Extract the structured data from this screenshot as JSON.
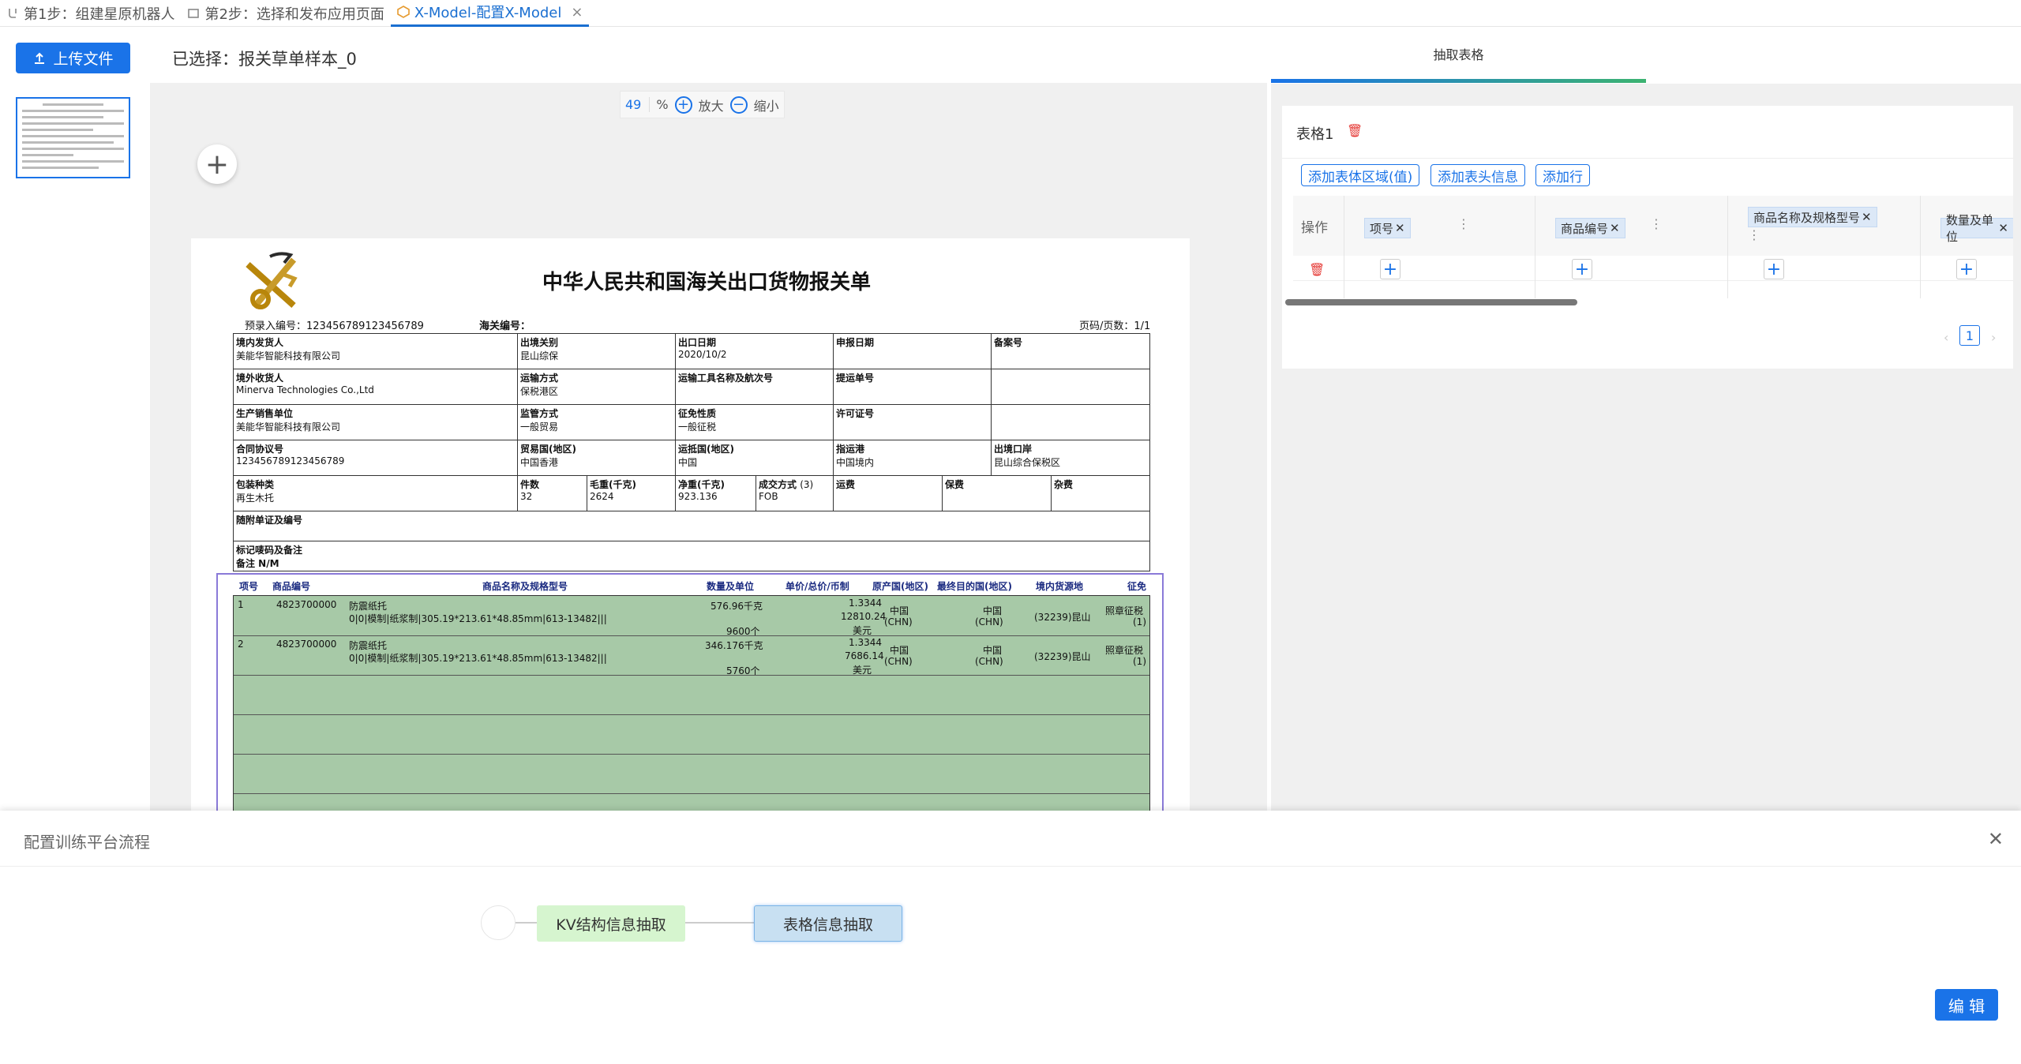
{
  "tabs": [
    {
      "label": "第1步：组建星原机器人"
    },
    {
      "label": "第2步：选择和发布应用页面"
    },
    {
      "label": "X-Model-配置X-Model"
    }
  ],
  "toolbar": {
    "upload_label": "上传文件",
    "selected_text": "已选择：报关草单样本_0"
  },
  "zoom": {
    "value": "49",
    "unit": "%",
    "zoom_in": "放大",
    "zoom_out": "缩小"
  },
  "document": {
    "title": "中华人民共和国海关出口货物报关单",
    "pre_entry": "预录入编号：123456789123456789",
    "customs_no": "海关编号：",
    "page": "页码/页数：1/1",
    "rows": [
      [
        {
          "h": "境内发货人",
          "v": "美能华智能科技有限公司"
        },
        {
          "h": "出境关别",
          "v": "昆山综保"
        },
        {
          "h": "出口日期",
          "v": "2020/10/2"
        },
        {
          "h": "申报日期",
          "v": ""
        },
        {
          "h": "备案号",
          "v": ""
        }
      ],
      [
        {
          "h": "境外收货人",
          "v": "Minerva Technologies Co.,Ltd"
        },
        {
          "h": "运输方式",
          "v": "保税港区"
        },
        {
          "h": "运输工具名称及航次号",
          "v": ""
        },
        {
          "h": "提运单号",
          "v": ""
        },
        {
          "h": "",
          "v": ""
        }
      ],
      [
        {
          "h": "生产销售单位",
          "v": "美能华智能科技有限公司"
        },
        {
          "h": "监管方式",
          "v": "一般贸易"
        },
        {
          "h": "征免性质",
          "v": "一般征税"
        },
        {
          "h": "许可证号",
          "v": ""
        },
        {
          "h": "",
          "v": ""
        }
      ],
      [
        {
          "h": "合同协议号",
          "v": "123456789123456789"
        },
        {
          "h": "贸易国(地区)",
          "v": "中国香港"
        },
        {
          "h": "运抵国(地区)",
          "v": "中国"
        },
        {
          "h": "指运港",
          "v": "中国境内"
        },
        {
          "h": "出境口岸",
          "v": "昆山综合保税区"
        }
      ]
    ],
    "row5": [
      {
        "h": "包装种类",
        "v": "再生木托"
      },
      {
        "h": "件数",
        "v": "32"
      },
      {
        "h": "毛重(千克)",
        "v": "2624"
      },
      {
        "h": "净重(千克)",
        "v": "923.136"
      },
      {
        "h": "成交方式",
        "v": "FOB",
        "extra": "(3)"
      },
      {
        "h": "运费",
        "v": ""
      },
      {
        "h": "保费",
        "v": ""
      },
      {
        "h": "杂费",
        "v": ""
      }
    ],
    "attached": "随附单证及编号",
    "marks_title": "标记唛码及备注",
    "marks_value": "备注  N/M",
    "item_headers": [
      "项号",
      "商品编号",
      "商品名称及规格型号",
      "数量及单位",
      "单价/总价/币制",
      "原产国(地区)",
      "最终目的国(地区)",
      "境内货源地",
      "征免"
    ],
    "items": [
      {
        "no": "1",
        "code": "4823700000",
        "name": "防震纸托",
        "spec": "0|0|模制|纸浆制|305.19*213.61*48.85mm|613-13482|||",
        "qty1": "576.96千克",
        "qty2": "9600个",
        "price": "1.3344",
        "total": "12810.24",
        "cur": "美元",
        "origin": "中国",
        "origin2": "(CHN)",
        "dest": "中国",
        "dest2": "(CHN)",
        "source": "(32239)昆山",
        "levy": "照章征税",
        "levy2": "(1)"
      },
      {
        "no": "2",
        "code": "4823700000",
        "name": "防震纸托",
        "spec": "0|0|模制|纸浆制|305.19*213.61*48.85mm|613-13482|||",
        "qty1": "346.176千克",
        "qty2": "5760个",
        "price": "1.3344",
        "total": "7686.14",
        "cur": "美元",
        "origin": "中国",
        "origin2": "(CHN)",
        "dest": "中国",
        "dest2": "(CHN)",
        "source": "(32239)昆山",
        "levy": "照章征税",
        "levy2": "(1)"
      }
    ]
  },
  "right_panel": {
    "tab_label": "抽取表格",
    "table_title": "表格1",
    "buttons": [
      "添加表体区域(值)",
      "添加表头信息",
      "添加行"
    ],
    "op_label": "操作",
    "columns": [
      "项号",
      "商品编号",
      "商品名称及规格型号",
      "数量及单位"
    ],
    "page": "1"
  },
  "dialog": {
    "title": "配置训练平台流程",
    "node_kv": "KV结构信息抽取",
    "node_table": "表格信息抽取",
    "edit_label": "编 辑"
  },
  "colors": {
    "accent": "#1a73e8",
    "danger": "#e53935",
    "kv_node": "#d6f5cf",
    "table_node": "#c8e0f2",
    "highlight": "#a7c9a7"
  }
}
